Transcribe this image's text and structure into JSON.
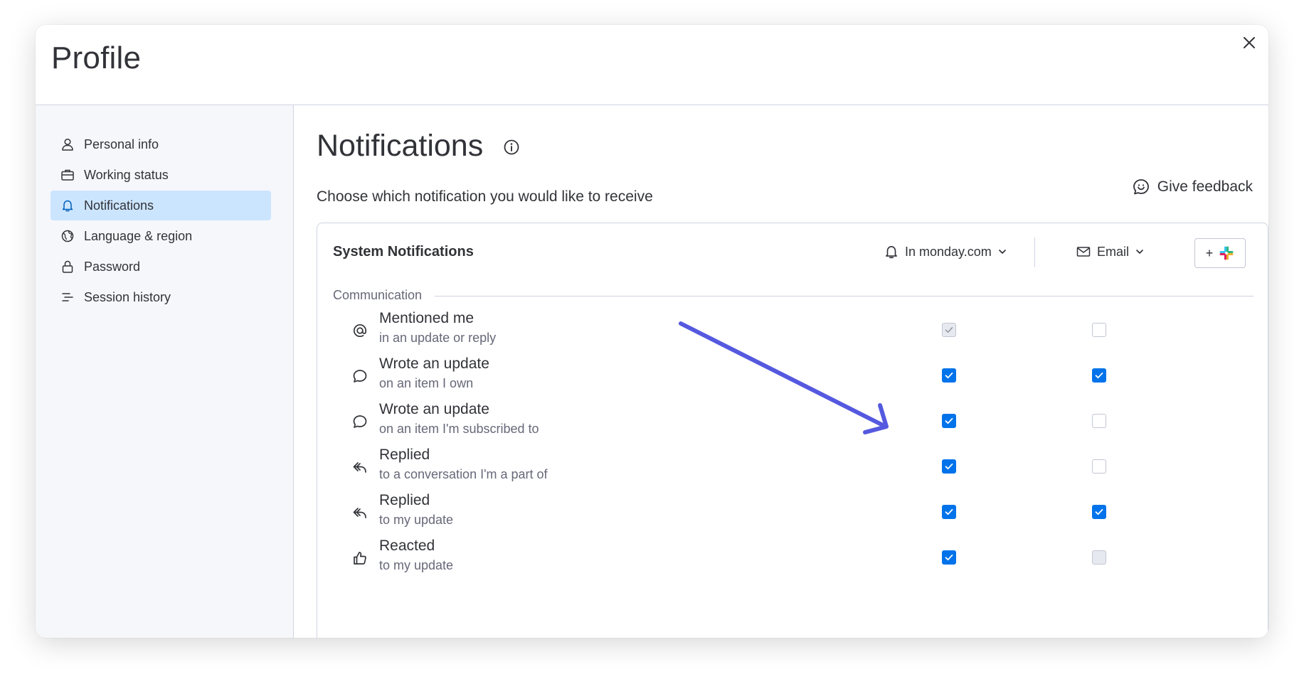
{
  "modal": {
    "title": "Profile"
  },
  "sidebar": {
    "items": [
      {
        "label": "Personal info",
        "icon": "person-icon",
        "active": false
      },
      {
        "label": "Working status",
        "icon": "briefcase-icon",
        "active": false
      },
      {
        "label": "Notifications",
        "icon": "bell-icon",
        "active": true
      },
      {
        "label": "Language & region",
        "icon": "globe-icon",
        "active": false
      },
      {
        "label": "Password",
        "icon": "lock-icon",
        "active": false
      },
      {
        "label": "Session history",
        "icon": "list-icon",
        "active": false
      }
    ]
  },
  "main": {
    "title": "Notifications",
    "subtitle": "Choose which notification you would like to receive",
    "feedback_label": "Give feedback"
  },
  "card": {
    "title": "System Notifications",
    "columns": {
      "in_app": "In monday.com",
      "email": "Email",
      "slack_plus": "+"
    },
    "section": "Communication",
    "rows": [
      {
        "title": "Mentioned me",
        "subtitle": "in an update or reply",
        "icon": "at-sign-icon",
        "in_app": "disabled-checked",
        "email": "unchecked"
      },
      {
        "title": "Wrote an update",
        "subtitle": "on an item I own",
        "icon": "speech-bubble-icon",
        "in_app": "checked",
        "email": "checked"
      },
      {
        "title": "Wrote an update",
        "subtitle": "on an item I'm subscribed to",
        "icon": "speech-bubble-icon",
        "in_app": "checked",
        "email": "unchecked"
      },
      {
        "title": "Replied",
        "subtitle": "to a conversation I'm a part of",
        "icon": "reply-icon",
        "in_app": "checked",
        "email": "unchecked"
      },
      {
        "title": "Replied",
        "subtitle": "to my update",
        "icon": "reply-icon",
        "in_app": "checked",
        "email": "checked"
      },
      {
        "title": "Reacted",
        "subtitle": "to my update",
        "icon": "thumbs-up-icon",
        "in_app": "checked",
        "email": "disabled"
      }
    ]
  },
  "colors": {
    "primary": "#0073ea",
    "active_nav": "#cce5ff",
    "annotation_arrow": "#5559df",
    "text": "#323338",
    "text_secondary": "#676879"
  }
}
